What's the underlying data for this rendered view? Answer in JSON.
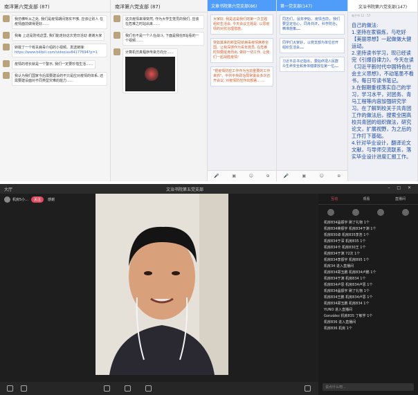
{
  "panels": {
    "chat1": {
      "title": "南洋第六党支部 (87)",
      "messages": [
        {
          "text": "我仿佛听从之处, 我们是疫情期间落实不够, 应该让别人 在疫情面前做得更好……"
        },
        {
          "text": "我每 上这是防线这里, 我们能走好这次党日活动 谢谢大家"
        },
        {
          "text": "转载了一个有关病毒介绍的小视频。发送链接:",
          "link": "https://www.bilibili.com/video/av84177694?p=1"
        },
        {
          "text": "疫情的增长就是一个警示, 我们一定要珍惜生活……"
        },
        {
          "text": "我认为我们国家今后需要建设的不只是应对疫情的体系, 还需要建设面对不同类型灾难的能力……"
        }
      ]
    },
    "chat2": {
      "title": "南洋第六党支部 (87)",
      "messages": [
        {
          "text": "这次疫情来得突然, 作为大学生党员的我们, 应该在危难之时站出来……"
        },
        {
          "text": "我们也不是一个人在战斗, 下面是我在B站看的一个视频……"
        },
        {
          "text": "计算机仿真程序传染方向分……"
        }
      ]
    },
    "chat3": {
      "title": "文章书院第六党支部(86)",
      "messages": [
        "大家好, 我是这是我们的第一次主题组织生活会, 今天会议主题是: 以思疫情的对抗治理措施。",
        "突如其来的新型冠状病毒疫情席卷全国。让我深感作为青年党员, 在危难时刻要挺身而出, 做好一切工作, 让我们一起战胜疫情!",
        "\"把疫情防控工作作为当前重要的工作来抓\"。中共中央政治局常委会多次召开会议, 对疫情防控作出部署……"
      ]
    },
    "chat4": {
      "title": "第一党支部(147)",
      "messages": [
        "同志们, 鼠年伊始, 疫情当前, 我们要坚定信心, 同舟共济, 科学防治, 精准施策……",
        "同学们大家好, 以党支部为单位召开组织生活会……",
        "习近平总书记指出, 要始终把人民群众生命安全和身体健康放在第一位……"
      ]
    },
    "chat5": {
      "title": "文治书院第六党支部(147)",
      "sender": "电子书 12 : 57",
      "content": "自己的做法:\n1.坚持在家锻炼，与吃好【美丽思想】一起做做大健运动。\n2.坚持读书学习，现已经读完《引爆自律力》，今天在读《习近平新时代中国特色社会主义思想》，不动笔墨不看书，每日写读书笔记。\n3.在假期重视落实自己的学习，学习水平，对团务、青马工程等内容加强研究学习。在了解到校关于共青团工作的做法后，搜索全国高校共青团的组织做法，研究论文，扩展视野，为之后的工作打下基础。\n4.针对毕业设计，翻译论文文献，与导师交流联系，落实毕业设计进度汇报工作。"
    }
  },
  "stream": {
    "window_title": "文治书院第五党支部",
    "left_label": "大厅",
    "host_name": "机房5小...",
    "host_badge": "关注",
    "host_extra": "感谢",
    "tabs": [
      "互动",
      "观看",
      "直播间"
    ],
    "active_tab": "互动",
    "input_placeholder": "说点什么吧...",
    "comments": [
      "机房834晶振宇 刷了礼物 1个",
      "机房834荣振宇 机房834于渊 1个",
      "机房830卓 机房835李浩 1个",
      "机房834于深 机房835 1个",
      "机房834卡 机房830王 1个",
      "机房834于渊 72次 1个",
      "机房834李振宇 机房895 1个",
      "机房34 进入直播间",
      "机房834郑玉鹏 机房834卢鹏 1个",
      "机房834于渊 机房834 1个",
      "机房834卢思 机房834卢思 1个",
      "机房834晶振宇 刷了礼物 1个",
      "机房834王鹏 机房834卢思 1个",
      "机房834郑玉鹏 机房834 1个",
      "YUNO 进入直播间",
      "González 机房835 丁敏学 1个",
      "机房836 进入直播间",
      "机房836 机房 1个"
    ]
  },
  "colors": {
    "accent": "#e24b5d",
    "qqblue": "#4f9cf9",
    "textblue": "#1c4aa8"
  }
}
